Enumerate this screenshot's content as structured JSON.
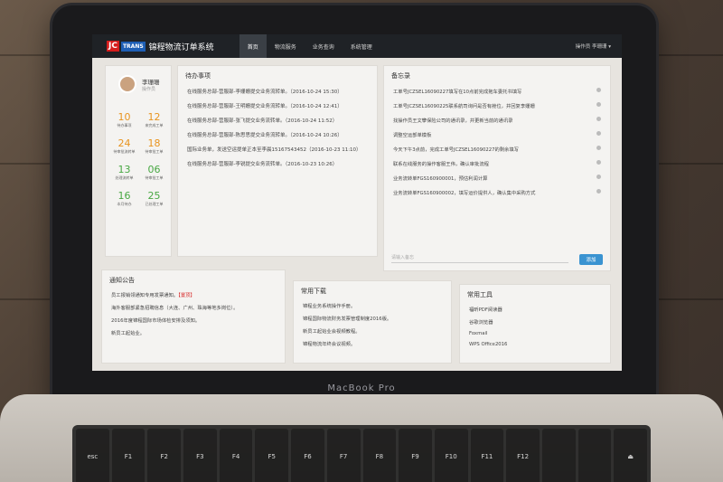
{
  "device_label": "MacBook Pro",
  "app": {
    "logo_jc": "JC",
    "logo_trans": "TRANS",
    "title": "锦程物流订单系统",
    "nav": [
      "首页",
      "物流服务",
      "业务查询",
      "系统管理"
    ],
    "user_menu": "操作员 李珊珊 ▾"
  },
  "profile": {
    "name": "李珊珊",
    "role": "操作员",
    "stats": [
      {
        "value": "10",
        "label": "待办事项",
        "color": "#e8941f"
      },
      {
        "value": "12",
        "label": "来完成工单",
        "color": "#e8941f"
      },
      {
        "value": "24",
        "label": "待审批流转单",
        "color": "#e8941f"
      },
      {
        "value": "18",
        "label": "待审批工单",
        "color": "#e8941f"
      },
      {
        "value": "13",
        "label": "处理流转单",
        "color": "#48a843"
      },
      {
        "value": "06",
        "label": "待审批工单",
        "color": "#48a843"
      },
      {
        "value": "16",
        "label": "本月待办",
        "color": "#48a843"
      },
      {
        "value": "25",
        "label": "已处理工单",
        "color": "#48a843"
      }
    ]
  },
  "todo": {
    "title": "待办事项",
    "items": [
      "在线服务总部-营服部-李姗姗提交业务流转单。（2016-10-24 15:30）",
      "在线服务总部-营服部-王明姗提交业务流转单。（2016-10-24 12:41）",
      "在线服务总部-营服部-张飞提交业务流转单。（2016-10-24 11:52）",
      "在线服务总部-营服部-陈思思提交业务流转单。（2016-10-24 10:26）",
      "国际业务单，发送空运提单正本至李晨15167543452（2016-10-23 11:10）",
      "在线服务总部-营服部-李锐提交业务流转单。（2016-10-23 10:26）"
    ]
  },
  "memo": {
    "title": "备忘录",
    "items": [
      "工单号JCZSEL16090227填写在10点前完成拖车委托书填写",
      "工单号JCZSEL16090225联系航司询问是否有舱位，并回复李姗姗",
      "找操作员王文攀保险公司的通讯录，并更新当前的通讯录",
      "调整空运部单模板",
      "今天下午3点前，完成工单号JCZSEL16090227的剩余填写",
      "联系在线服务的操作客服王伟，确认审批流程",
      "业务流转单FGS160900001，预估利润计算",
      "业务流转单FGS160900002，填写运价提供人，确认集中采购方式"
    ],
    "input_placeholder": "请输入备忘",
    "add_label": "添加"
  },
  "notice": {
    "title": "通知公告",
    "items": [
      {
        "text": "员工报销领通知专用发票通知。",
        "tag": "【置顶】"
      },
      {
        "text": "海外客服部紧急招聘信息（大连、广州、珠海等地多岗位）。",
        "tag": ""
      },
      {
        "text": "2016年度锦程国际市场体检安排及须知。",
        "tag": ""
      },
      {
        "text": "新员工起始业。",
        "tag": ""
      }
    ]
  },
  "downloads": {
    "title": "常用下载",
    "items": [
      "锦程业务系统操作手册。",
      "锦程国际物流财务发票管理制度2016版。",
      "新员工起始业会视频教程。",
      "锦程物流年终会议视频。"
    ]
  },
  "tools": {
    "title": "常用工具",
    "items": [
      "福昕PDF阅读器",
      "谷歌浏览器",
      "Foxmail",
      "WPS Office2016"
    ]
  }
}
